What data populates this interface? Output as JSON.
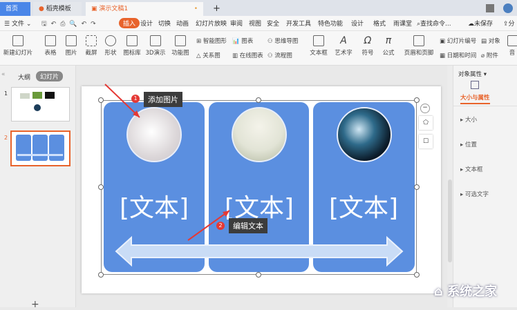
{
  "tabs": {
    "home": "首页",
    "template": "稻壳模板",
    "doc": "演示文稿1",
    "add": "+"
  },
  "menu": {
    "file": "文件",
    "items": [
      "插入",
      "设计",
      "切换",
      "动画",
      "幻灯片放映",
      "审阅",
      "视图",
      "安全",
      "开发工具",
      "特色功能",
      "设计",
      "格式",
      "雨课堂"
    ],
    "search": "查找命令...",
    "unsaved": "未保存",
    "share": "分"
  },
  "ribbon": {
    "new_slide": "新建幻灯片",
    "table": "表格",
    "picture": "图片",
    "screenshot": "截屏",
    "shape": "形状",
    "icon_lib": "图标库",
    "3d": "3D演示",
    "func": "功能图",
    "smart": "智能图形",
    "chart": "图表",
    "relation": "关系图",
    "online_chart": "在线图表",
    "mindmap": "思维导图",
    "flow": "流程图",
    "textbox": "文本框",
    "wordart": "艺术字",
    "symbol": "符号",
    "formula": "公式",
    "header_footer": "页眉和页脚",
    "slide_no": "幻灯片编号",
    "object": "对象",
    "datetime": "日期和时间",
    "attach": "附件",
    "audio": "音"
  },
  "left": {
    "outline": "大纲",
    "slides": "幻灯片",
    "n1": "1",
    "n2": "2"
  },
  "right": {
    "title": "对象属性",
    "tab": "大小与属性",
    "sections": [
      "大小",
      "位置",
      "文本框",
      "可选文字"
    ]
  },
  "slide": {
    "texts": [
      "[文本]",
      "[文本]",
      "[文本]"
    ]
  },
  "callouts": {
    "one": {
      "n": "1",
      "label": "添加图片"
    },
    "two": {
      "n": "2",
      "label": "编辑文本"
    }
  },
  "watermark": "系统之家",
  "accent": "#e8632b"
}
